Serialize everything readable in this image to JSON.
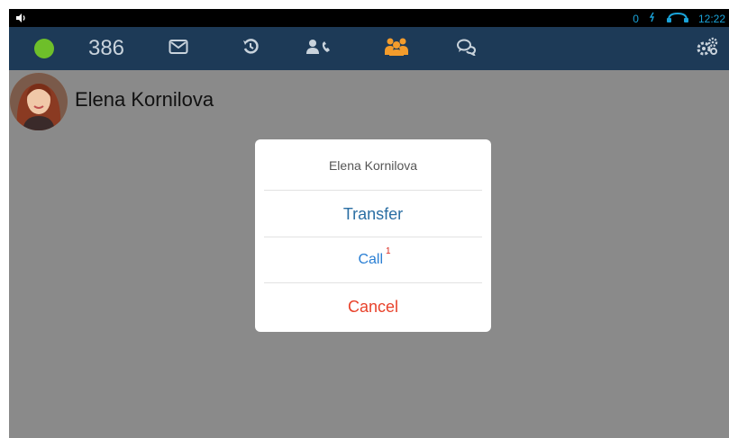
{
  "status_bar": {
    "indicator": "0",
    "time": "12:22",
    "colors": {
      "accent": "#1aa3d9"
    }
  },
  "nav": {
    "extension": "386",
    "presence_color": "#6ebf2a",
    "active_color": "#f39c2c",
    "icons": [
      "envelope-icon",
      "history-icon",
      "contacts-call-icon",
      "groups-icon",
      "chat-icon",
      "settings-gears-icon"
    ]
  },
  "contact": {
    "name": "Elena Kornilova"
  },
  "dialog": {
    "title": "Elena Kornilova",
    "transfer_label": "Transfer",
    "call_label": "Call",
    "call_badge": "1",
    "cancel_label": "Cancel"
  }
}
